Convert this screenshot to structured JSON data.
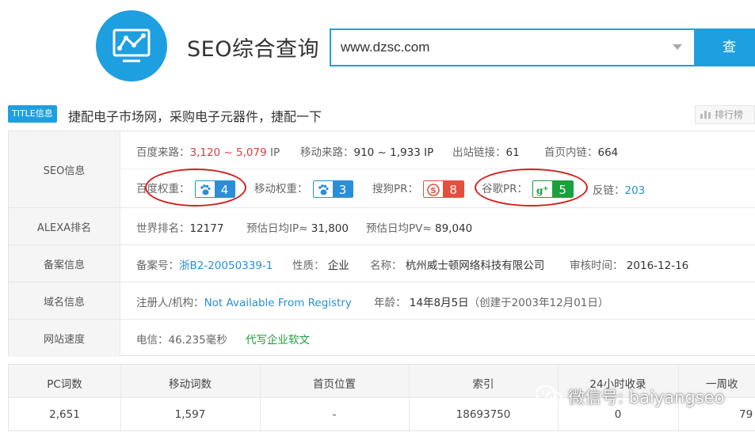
{
  "header": {
    "app_title": "SEO综合查询",
    "search_value": "www.dzsc.com",
    "search_button": "查 询",
    "brand_color": "#1e9fe0"
  },
  "title_row": {
    "badge": "TITLE信息",
    "text": "捷配电子市场网，采购电子元器件，捷配一下",
    "rank_button": "排行榜"
  },
  "seo": {
    "label": "SEO信息",
    "baidu_traffic_key": "百度来路：",
    "baidu_traffic_value": "3,120 ~ 5,079",
    "baidu_traffic_unit": "IP",
    "mobile_traffic_key": "移动来路：",
    "mobile_traffic_value": "910 ~ 1,933 IP",
    "outbound_key": "出站链接：",
    "outbound_value": "61",
    "home_internal_key": "首页内链：",
    "home_internal_value": "664",
    "baidu_weight_key": "百度权重：",
    "baidu_weight_value": "4",
    "mobile_weight_key": "移动权重：",
    "mobile_weight_value": "3",
    "sogou_key": "搜狗PR：",
    "sogou_value": "8",
    "google_key": "谷歌PR：",
    "google_value": "5",
    "backlink_key": "反链：",
    "backlink_value": "203"
  },
  "alexa": {
    "label": "ALEXA排名",
    "world_rank_key": "世界排名：",
    "world_rank_value": "12177",
    "est_ip_key": "预估日均IP≈",
    "est_ip_value": "31,800",
    "est_pv_key": "预估日均PV≈",
    "est_pv_value": "89,040"
  },
  "icp": {
    "label": "备案信息",
    "number_key": "备案号：",
    "number_value": "浙B2-20050339-1",
    "nature_key": "性质：",
    "nature_value": "企业",
    "name_key": "名称：",
    "name_value": "杭州威士顿网络科技有限公司",
    "audit_key": "审核时间：",
    "audit_value": "2016-12-16"
  },
  "domain": {
    "label": "域名信息",
    "registrant_key": "注册人/机构：",
    "registrant_value": "Not Available From Registry",
    "age_key": "年龄：",
    "age_value": "14年8月5日",
    "created": "（创建于2003年12月01日）"
  },
  "speed": {
    "label": "网站速度",
    "telecom": "电信：46.235毫秒",
    "ad_link": "代写企业软文"
  },
  "stats_table": {
    "headers": [
      "PC词数",
      "移动词数",
      "首页位置",
      "索引",
      "24小时收录",
      "一周收"
    ],
    "values": [
      "2,651",
      "1,597",
      "-",
      "18693750",
      "0",
      "79"
    ]
  },
  "watermark": "微信号: baiyangseo",
  "colors": {
    "accent": "#1e9fe0",
    "red": "#e4393c",
    "green": "#1aa03c",
    "link": "#2a8fd6",
    "annotation": "#d0201c"
  }
}
